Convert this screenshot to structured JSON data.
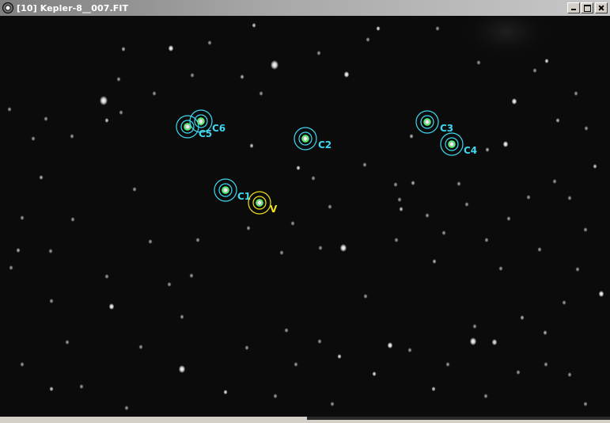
{
  "window": {
    "title": "[10] Kepler-8__007.FIT",
    "icon": "telescope-app-icon"
  },
  "controls": {
    "minimize": "minimize-icon",
    "maximize": "maximize-icon",
    "close": "close-icon"
  },
  "colors": {
    "comparison": "#3fd8f0",
    "variable": "#f0e21c",
    "sky": "#0b0b0b"
  },
  "annotations": {
    "comparisons": [
      {
        "label": "C1"
      },
      {
        "label": "C2"
      },
      {
        "label": "C3"
      },
      {
        "label": "C4"
      },
      {
        "label": "C5"
      },
      {
        "label": "C6"
      }
    ],
    "variable": {
      "label": "V"
    }
  }
}
